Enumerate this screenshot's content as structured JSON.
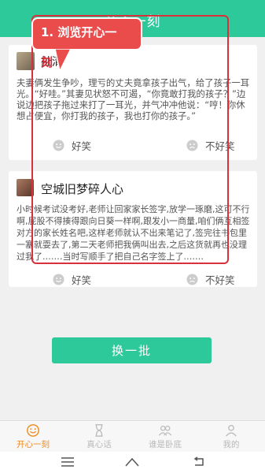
{
  "app": {
    "title": "开心一刻"
  },
  "annotation": {
    "label": "1. 浏览开心一刻",
    "label_line1": "1. 浏览开心一",
    "label_line2": "刻"
  },
  "jokes": [
    {
      "username": "扯清",
      "content": "夫妻俩发生争吵，理亏的丈夫竟拿孩子出气，给了孩子一耳光。“好哇。”其妻见状怒不可遏，“你竟敢打我的孩子？”边说边把孩子拖过来打了一耳光，并气冲冲他说：“哼！你休想占便宜，你打我的孩子，我也打你的孩子。”",
      "like_label": "好笑",
      "dislike_label": "不好笑"
    },
    {
      "username": "空城旧梦碎人心",
      "content": "小时候考试没考好,老师让回家家长签字,放学一琢磨,这可不行啊,屁股不得揍得跟向日葵一样啊,跟发小一商量,咱们俩互相签对方的家长姓名吧,这样老师就认不出来笔记了,签完往书包里一塞就耍去了,第二天老师把我俩叫出去,之后这货就再也没理过我了.……当时写顺手了把自己名字签上了.……",
      "like_label": "好笑",
      "dislike_label": "不好笑"
    }
  ],
  "refresh_button": {
    "label": "换一批"
  },
  "tabs": [
    {
      "label": "开心一刻",
      "icon": "smiley-icon",
      "active": true
    },
    {
      "label": "真心话",
      "icon": "hourglass-icon",
      "active": false
    },
    {
      "label": "谁是卧底",
      "icon": "group-icon",
      "active": false
    },
    {
      "label": "我的",
      "icon": "person-icon",
      "active": false
    }
  ],
  "colors": {
    "accent": "#2ec99a",
    "active_tab": "#f08a1e",
    "annotation": "#d9303b"
  }
}
